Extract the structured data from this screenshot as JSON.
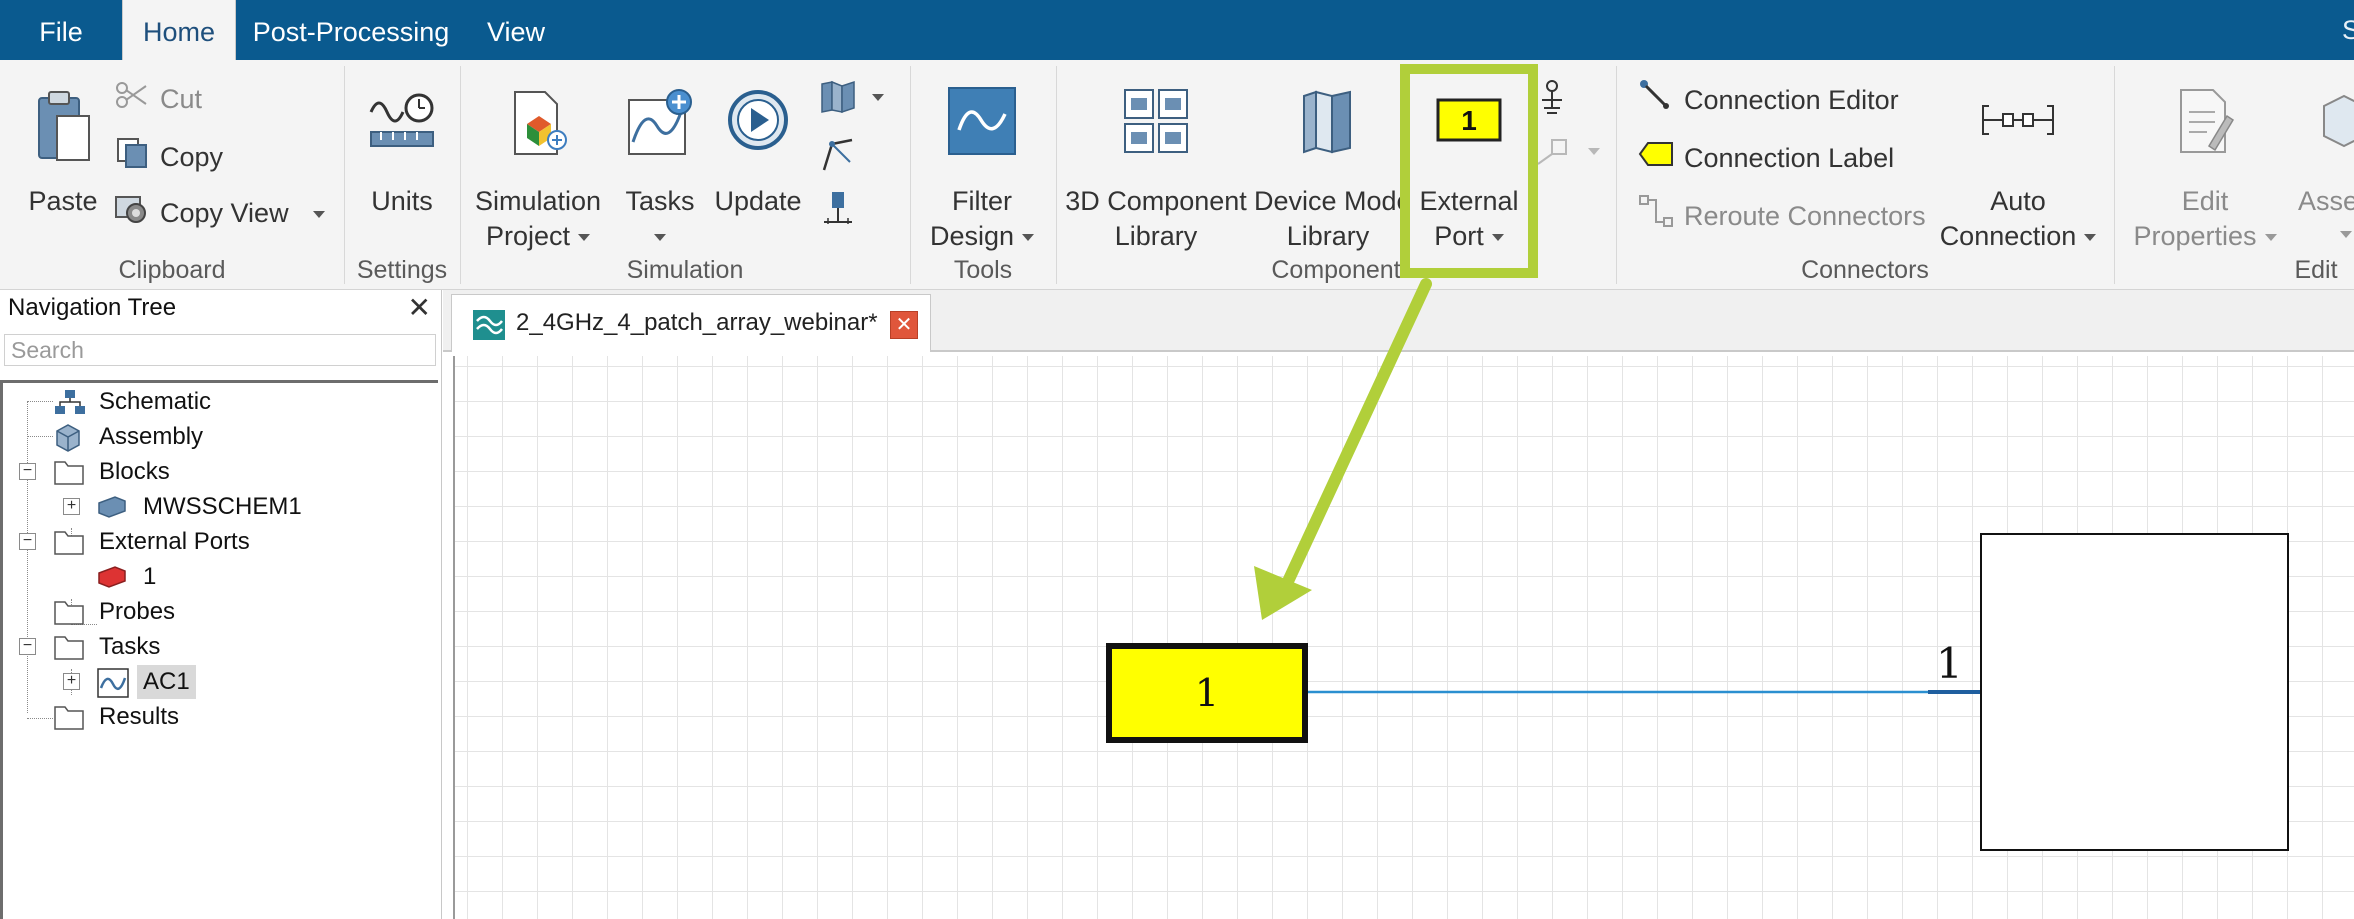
{
  "menu": {
    "tabs": [
      "File",
      "Home",
      "Post-Processing",
      "View"
    ],
    "active_tab": "Home",
    "right_partial": "S"
  },
  "ribbon": {
    "clipboard": {
      "paste": "Paste",
      "cut": "Cut",
      "copy": "Copy",
      "copy_view": "Copy View",
      "group_label": "Clipboard"
    },
    "settings": {
      "units": "Units",
      "group_label": "Settings"
    },
    "simulation": {
      "simulation_project_line1": "Simulation",
      "simulation_project_line2": "Project",
      "tasks": "Tasks",
      "update": "Update",
      "group_label": "Simulation"
    },
    "tools": {
      "filter_design_line1": "Filter",
      "filter_design_line2": "Design",
      "group_label": "Tools"
    },
    "components": {
      "component_library_line1": "3D Component",
      "component_library_line2": "Library",
      "device_model_line1": "Device Mode",
      "device_model_line2": "Library",
      "external_port_line1": "External",
      "external_port_line2": "Port",
      "external_port_icon_text": "1",
      "group_label": "Component"
    },
    "connectors": {
      "connection_editor": "Connection Editor",
      "connection_label": "Connection Label",
      "reroute_connectors": "Reroute Connectors",
      "auto_connection_line1": "Auto",
      "auto_connection_line2": "Connection",
      "group_label": "Connectors"
    },
    "edit": {
      "edit_properties_line1": "Edit",
      "edit_properties_line2": "Properties",
      "assembly_partial": "Asse",
      "group_label": "Edit"
    }
  },
  "navigation": {
    "title": "Navigation Tree",
    "close_symbol": "✕",
    "search_placeholder": "Search",
    "items": [
      {
        "label": "Schematic"
      },
      {
        "label": "Assembly"
      },
      {
        "label": "Blocks"
      },
      {
        "label": "MWSSCHEM1"
      },
      {
        "label": "External Ports"
      },
      {
        "label": "1"
      },
      {
        "label": "Probes"
      },
      {
        "label": "Tasks"
      },
      {
        "label": "AC1"
      },
      {
        "label": "Results"
      }
    ]
  },
  "document": {
    "tab_label": "2_4GHz_4_patch_array_webinar*",
    "tab_close_symbol": "✕"
  },
  "schematic": {
    "external_port_label": "1",
    "block_port_label": "1"
  },
  "colors": {
    "menubar": "#0a5a8f",
    "highlight": "#b1cf3a",
    "port_fill": "#ffff00",
    "connection_line": "#2a8fd0",
    "patch_array": "#2fd3d6"
  },
  "icons": [
    "paste-icon",
    "cut-icon",
    "copy-icon",
    "copy-view-icon",
    "units-icon",
    "simulation-project-icon",
    "tasks-icon",
    "update-icon",
    "filter-design-icon",
    "component-library-icon",
    "device-model-library-icon",
    "external-port-icon",
    "connection-editor-icon",
    "connection-label-icon",
    "reroute-connectors-icon",
    "auto-connection-icon",
    "edit-properties-icon"
  ]
}
